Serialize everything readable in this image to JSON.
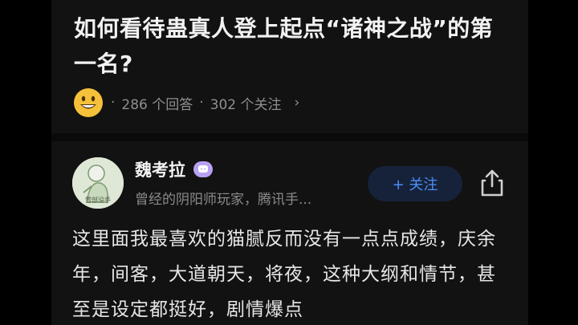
{
  "question": {
    "title": "如何看待蛊真人登上起点“诸神之战”的第一名?",
    "answer_count": "286 个回答",
    "follower_count": "302 个关注",
    "separator": "·"
  },
  "author": {
    "name": "魏考拉",
    "bio": "曾经的阴阳师玩家，腾讯手...",
    "avatar_caption": "雪部没手"
  },
  "actions": {
    "follow_label": "+ 关注"
  },
  "answer": {
    "text": "这里面我最喜欢的猫腻反而没有一点点成绩，庆余年，间客，大道朝天，将夜，这种大纲和情节，甚至是设定都挺好，剧情爆点"
  },
  "colors": {
    "background": "#121212",
    "accent": "#4d8ef7",
    "badge": "#b8a1f5"
  },
  "icons": [
    "smiley-emoji-icon",
    "chevron-right-icon",
    "member-badge-icon",
    "share-icon"
  ]
}
